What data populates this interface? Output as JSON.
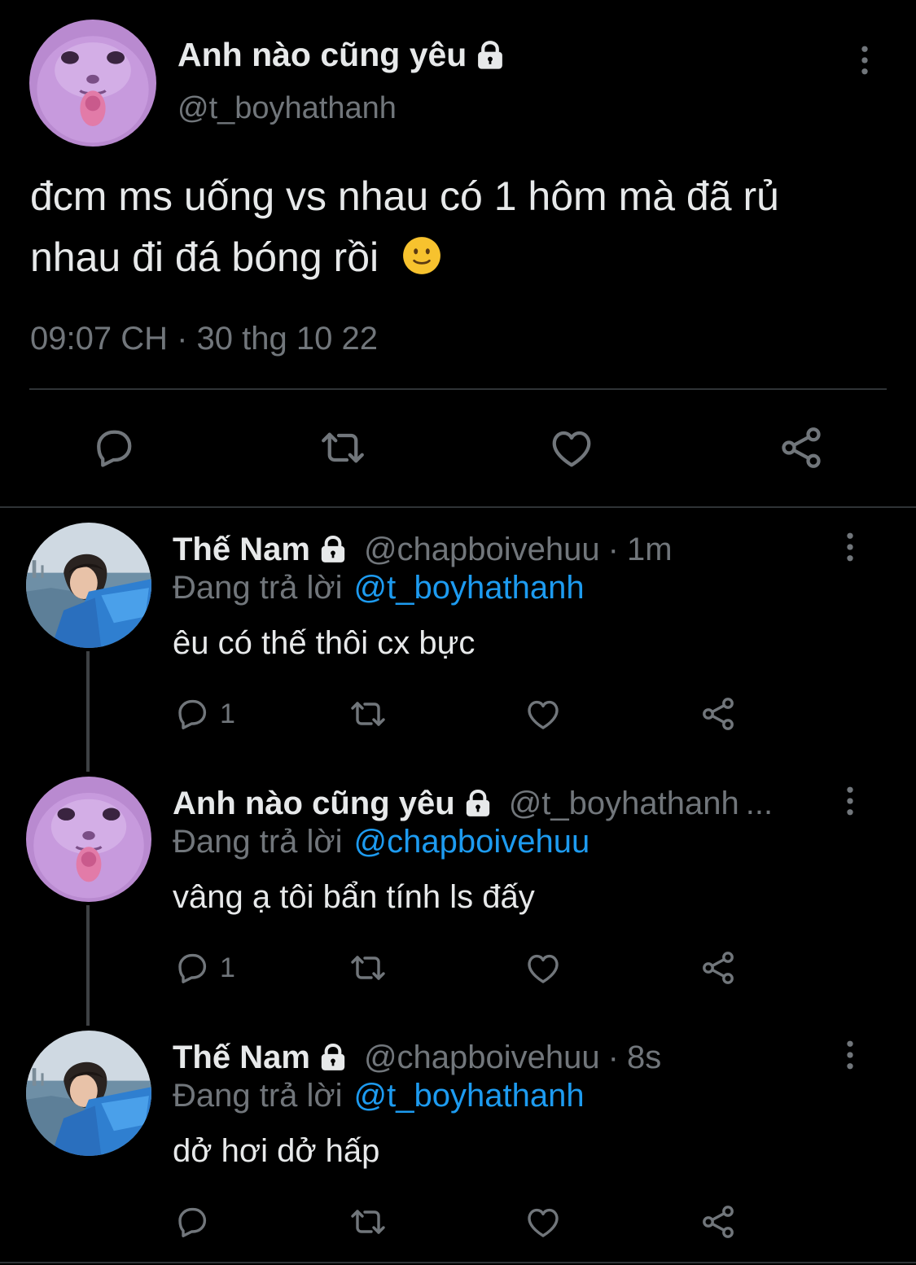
{
  "main_tweet": {
    "name": "Anh nào cũng yêu",
    "handle": "@t_boyhathanh",
    "text_line1": "đcm ms uống vs nhau có 1 hôm mà đã rủ",
    "text_line2": "nhau đi đá bóng rồi",
    "emoji": "🙂",
    "timestamp": "09:07 CH · 30 thg 10 22"
  },
  "replies": [
    {
      "name": "Thế Nam",
      "handle": "@chapboivehuu",
      "time": "1m",
      "replying_prefix": "Đang trả lời",
      "replying_to": "@t_boyhathanh",
      "text": "êu có thế thôi cx bực",
      "reply_count": "1"
    },
    {
      "name": "Anh nào cũng yêu",
      "handle": "@t_boyhathanh",
      "time": "",
      "truncated": "...",
      "replying_prefix": "Đang trả lời",
      "replying_to": "@chapboivehuu",
      "text": "vâng ạ tôi bẩn tính ls đấy",
      "reply_count": "1"
    },
    {
      "name": "Thế Nam",
      "handle": "@chapboivehuu",
      "time": "8s",
      "replying_prefix": "Đang trả lời",
      "replying_to": "@t_boyhathanh",
      "text": "dở hơi dở hấp",
      "reply_count": ""
    }
  ],
  "colors": {
    "background": "#000000",
    "text": "#e7e9ea",
    "secondary": "#71767b",
    "link": "#1d9bf0",
    "divider": "#2f3336"
  },
  "icons": [
    "lock-icon",
    "more-icon",
    "reply-icon",
    "retweet-icon",
    "like-icon",
    "share-icon"
  ]
}
